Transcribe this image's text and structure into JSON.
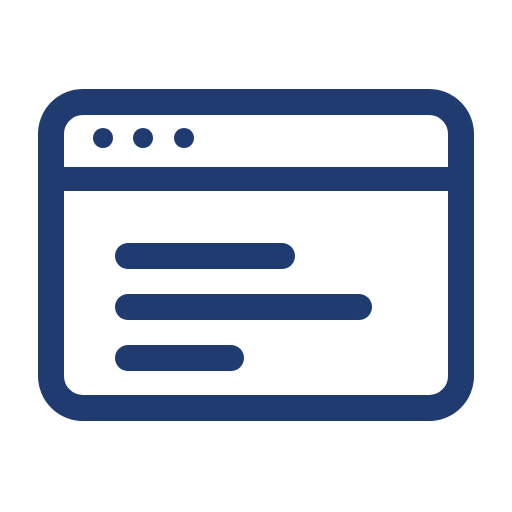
{
  "icon": {
    "name": "browser-window-icon",
    "color": "#1f3b6f",
    "background": "#ffffff",
    "window_controls": [
      "dot",
      "dot",
      "dot"
    ],
    "content_lines": [
      "line",
      "line",
      "line"
    ]
  }
}
